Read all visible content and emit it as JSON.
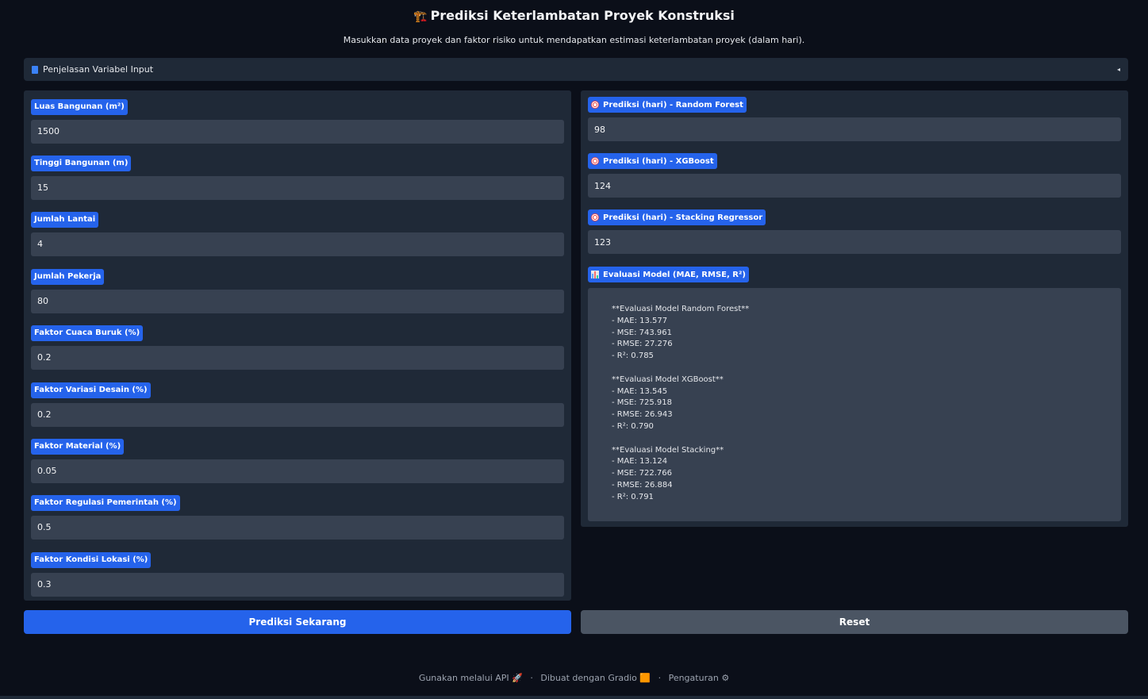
{
  "header": {
    "title": "Prediksi Keterlambatan Proyek Konstruksi",
    "title_icon": "🏗️",
    "subtitle": "Masukkan data proyek dan faktor risiko untuk mendapatkan estimasi keterlambatan proyek (dalam hari)."
  },
  "accordion": {
    "label": "Penjelasan Variabel Input",
    "icon": "book-icon",
    "arrow": "◂"
  },
  "inputs": [
    {
      "label": "Luas Bangunan (m²)",
      "value": "1500"
    },
    {
      "label": "Tinggi Bangunan (m)",
      "value": "15"
    },
    {
      "label": "Jumlah Lantai",
      "value": "4"
    },
    {
      "label": "Jumlah Pekerja",
      "value": "80"
    },
    {
      "label": "Faktor Cuaca Buruk (%)",
      "value": "0.2"
    },
    {
      "label": "Faktor Variasi Desain (%)",
      "value": "0.2"
    },
    {
      "label": "Faktor Material (%)",
      "value": "0.05"
    },
    {
      "label": "Faktor Regulasi Pemerintah (%)",
      "value": "0.5"
    },
    {
      "label": "Faktor Kondisi Lokasi (%)",
      "value": "0.3"
    }
  ],
  "outputs": [
    {
      "label": "Prediksi (hari) - Random Forest",
      "value": "98"
    },
    {
      "label": "Prediksi (hari) - XGBoost",
      "value": "124"
    },
    {
      "label": "Prediksi (hari) - Stacking Regressor",
      "value": "123"
    }
  ],
  "evaluation": {
    "label": "Evaluasi Model (MAE, RMSE, R²)",
    "text": "**Evaluasi Model Random Forest**\n- MAE: 13.577\n- MSE: 743.961\n- RMSE: 27.276\n- R²: 0.785\n\n**Evaluasi Model XGBoost**\n- MAE: 13.545\n- MSE: 725.918\n- RMSE: 26.943\n- R²: 0.790\n\n**Evaluasi Model Stacking**\n- MAE: 13.124\n- MSE: 722.766\n- RMSE: 26.884\n- R²: 0.791"
  },
  "buttons": {
    "predict": "Prediksi Sekarang",
    "reset": "Reset"
  },
  "footer": {
    "api": "Gunakan melalui API",
    "api_icon": "🚀",
    "gradio": "Dibuat dengan Gradio",
    "gradio_icon": "🟧",
    "settings": "Pengaturan",
    "settings_icon": "⚙"
  },
  "colors": {
    "background": "#0b0f19",
    "panel": "#1f2937",
    "input": "#374151",
    "accent": "#2563eb",
    "secondary_button": "#4b5563"
  }
}
